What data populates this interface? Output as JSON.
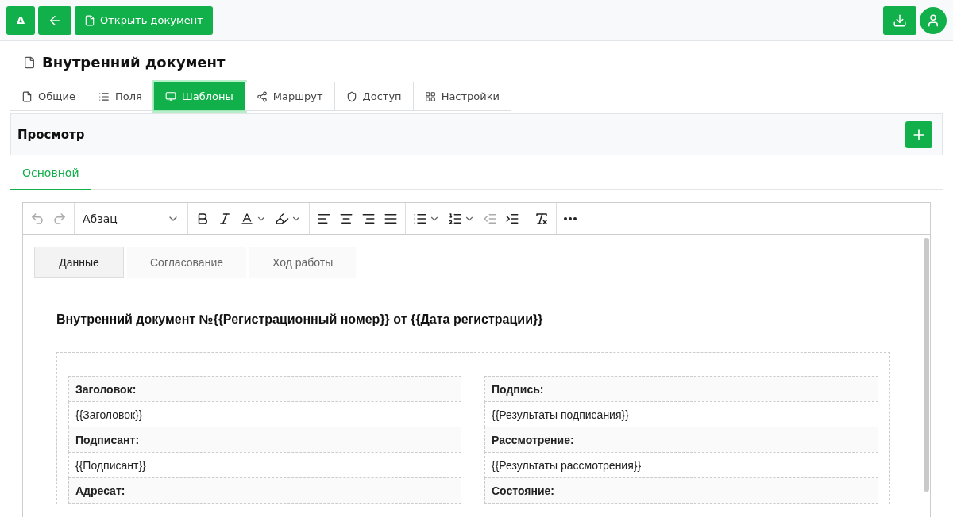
{
  "top_bar": {
    "delta_button": "Δ",
    "open_button": "Открыть документ"
  },
  "title": "Внутренний документ",
  "tabs": [
    {
      "label": "Общие",
      "selected": false
    },
    {
      "label": "Поля",
      "selected": false
    },
    {
      "label": "Шаблоны",
      "selected": true
    },
    {
      "label": "Маршрут",
      "selected": false
    },
    {
      "label": "Доступ",
      "selected": false
    },
    {
      "label": "Настройки",
      "selected": false
    }
  ],
  "panel": {
    "title": "Просмотр"
  },
  "subtabs": [
    {
      "label": "Основной",
      "selected": true
    }
  ],
  "editor": {
    "block_format": "Абзац",
    "content_tabs": [
      {
        "label": "Данные",
        "selected": true
      },
      {
        "label": "Согласование",
        "selected": false
      },
      {
        "label": "Ход работы",
        "selected": false
      }
    ],
    "heading": "Внутренний документ №{{Регистрационный номер}} от {{Дата регистрации}}",
    "columns": [
      [
        {
          "kind": "label",
          "text": "Заголовок:"
        },
        {
          "kind": "value",
          "text": "{{Заголовок}}"
        },
        {
          "kind": "label",
          "text": "Подписант:"
        },
        {
          "kind": "value",
          "text": "{{Подписант}}"
        },
        {
          "kind": "label",
          "text": "Адресат:"
        }
      ],
      [
        {
          "kind": "label",
          "text": "Подпись:"
        },
        {
          "kind": "value",
          "text": "{{Результаты подписания}}"
        },
        {
          "kind": "label",
          "text": "Рассмотрение:"
        },
        {
          "kind": "value",
          "text": "{{Результаты рассмотрения}}"
        },
        {
          "kind": "label",
          "text": "Состояние:"
        }
      ]
    ]
  }
}
